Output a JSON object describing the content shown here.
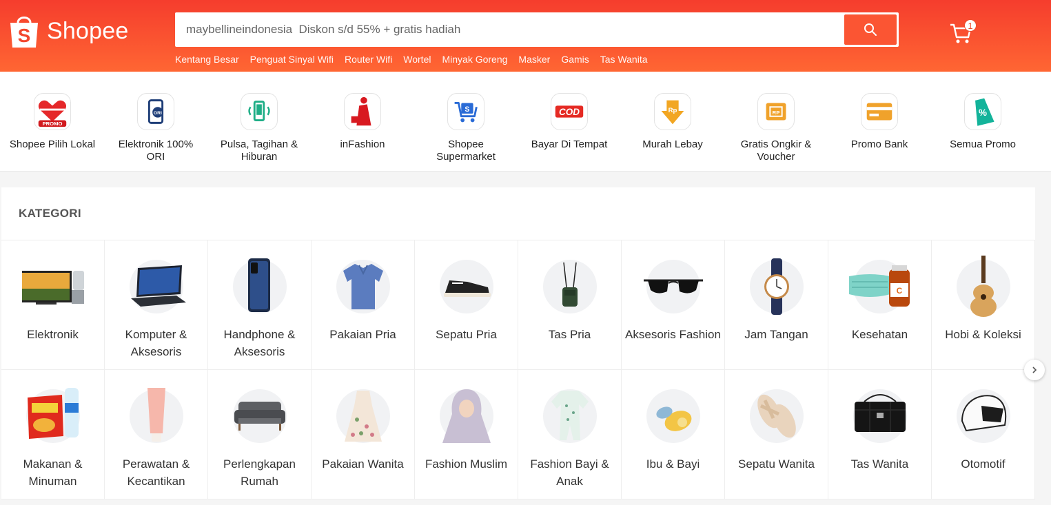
{
  "header": {
    "logo_text": "Shopee",
    "search": {
      "placeholder": "maybellineindonesia  Diskon s/d 55% + gratis hadiah"
    },
    "suggestions": [
      "Kentang Besar",
      "Penguat Sinyal Wifi",
      "Router Wifi",
      "Wortel",
      "Minyak Goreng",
      "Masker",
      "Gamis",
      "Tas Wanita"
    ],
    "cart_count": "1"
  },
  "quick_nav": [
    {
      "label": "Shopee Pilih Lokal",
      "icon": "promo-heart-icon"
    },
    {
      "label": "Elektronik 100% ORI",
      "icon": "ori-phone-icon"
    },
    {
      "label": "Pulsa, Tagihan & Hiburan",
      "icon": "phone-signal-icon"
    },
    {
      "label": "inFashion",
      "icon": "fashion-woman-icon"
    },
    {
      "label": "Shopee Supermarket",
      "icon": "supermarket-cart-icon"
    },
    {
      "label": "Bayar Di Tempat",
      "icon": "cod-icon"
    },
    {
      "label": "Murah Lebay",
      "icon": "rupiah-down-icon"
    },
    {
      "label": "Gratis Ongkir & Voucher",
      "icon": "voucher-icon"
    },
    {
      "label": "Promo Bank",
      "icon": "bank-card-icon"
    },
    {
      "label": "Semua Promo",
      "icon": "percent-tag-icon"
    }
  ],
  "categories": {
    "title": "KATEGORI",
    "items": [
      {
        "label": "Elektronik",
        "icon": "tv-blender-icon"
      },
      {
        "label": "Komputer & Aksesoris",
        "icon": "laptop-icon"
      },
      {
        "label": "Handphone & Aksesoris",
        "icon": "smartphone-icon"
      },
      {
        "label": "Pakaian Pria",
        "icon": "polo-shirt-icon"
      },
      {
        "label": "Sepatu Pria",
        "icon": "sneaker-icon"
      },
      {
        "label": "Tas Pria",
        "icon": "sling-bag-icon"
      },
      {
        "label": "Aksesoris Fashion",
        "icon": "sunglasses-icon"
      },
      {
        "label": "Jam Tangan",
        "icon": "watch-icon"
      },
      {
        "label": "Kesehatan",
        "icon": "mask-vitamin-icon"
      },
      {
        "label": "Hobi & Koleksi",
        "icon": "ukulele-icon"
      },
      {
        "label": "Makanan & Minuman",
        "icon": "snack-water-icon"
      },
      {
        "label": "Perawatan & Kecantikan",
        "icon": "tube-cream-icon"
      },
      {
        "label": "Perlengkapan Rumah",
        "icon": "sofa-icon"
      },
      {
        "label": "Pakaian Wanita",
        "icon": "dress-icon"
      },
      {
        "label": "Fashion Muslim",
        "icon": "hijab-icon"
      },
      {
        "label": "Fashion Bayi & Anak",
        "icon": "baby-romper-icon"
      },
      {
        "label": "Ibu & Bayi",
        "icon": "pacifier-icon"
      },
      {
        "label": "Sepatu Wanita",
        "icon": "sandal-icon"
      },
      {
        "label": "Tas Wanita",
        "icon": "handbag-icon"
      },
      {
        "label": "Otomotif",
        "icon": "helmet-icon"
      }
    ]
  },
  "colors": {
    "brand": "#ee4d2d",
    "header_gradient_start": "#f53d2d",
    "header_gradient_end": "#ff6633"
  }
}
